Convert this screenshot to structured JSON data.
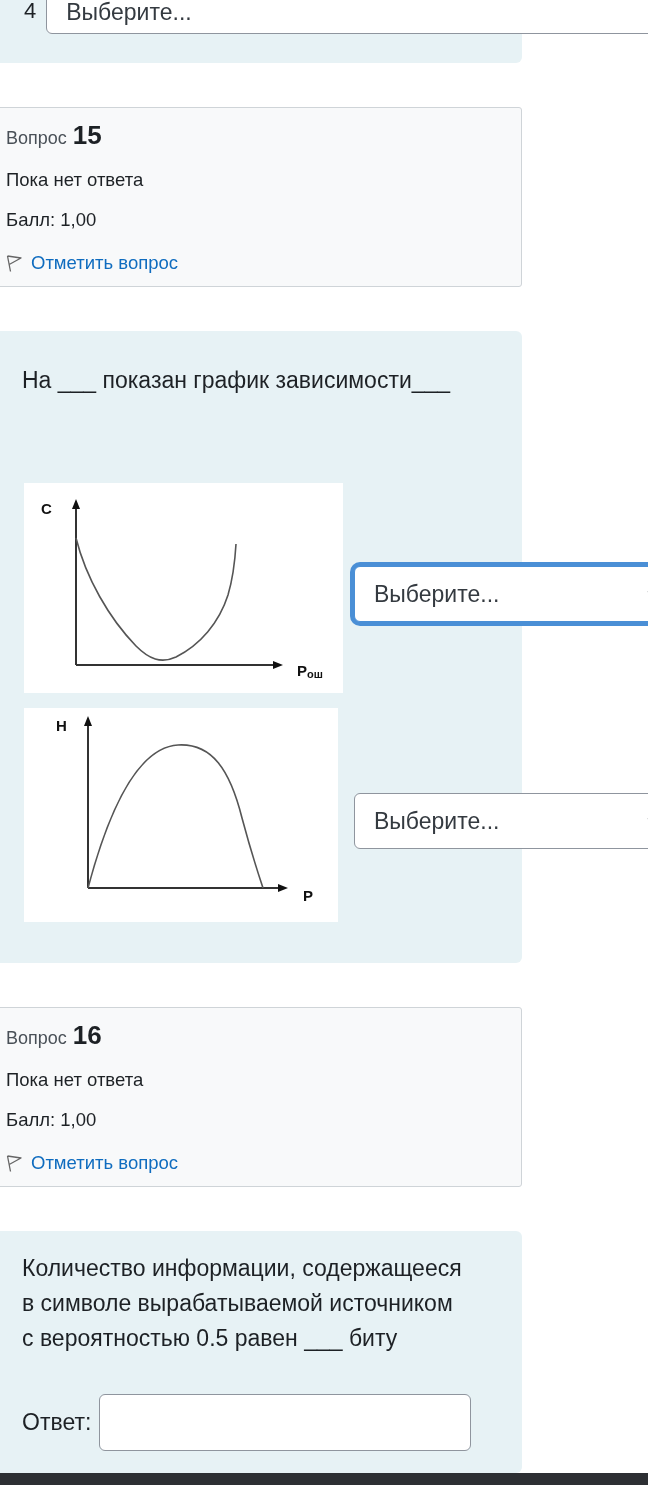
{
  "top_fragment": {
    "row_number": "4",
    "select": {
      "value": "Выберите...",
      "focused": false
    }
  },
  "questions": [
    {
      "info": {
        "label": "Вопрос",
        "number": "15",
        "status": "Пока нет ответа",
        "grade": "Балл: 1,00",
        "flag_link": "Отметить вопрос"
      },
      "kind": "match",
      "text": "На ___ показан график зависимости___",
      "items": [
        {
          "figure": {
            "kind": "u-curve",
            "y_label": "C",
            "x_label": "P$_{ош}$"
          },
          "select": {
            "value": "Выберите...",
            "focused": true
          }
        },
        {
          "figure": {
            "kind": "arch",
            "y_label": "H",
            "x_label": "P"
          },
          "select": {
            "value": "Выберите...",
            "focused": false
          }
        }
      ]
    },
    {
      "info": {
        "label": "Вопрос",
        "number": "16",
        "status": "Пока нет ответа",
        "grade": "Балл: 1,00",
        "flag_link": "Отметить вопрос"
      },
      "kind": "short-answer",
      "text": "Количество информации, содержащееся в символе вырабатываемой источником с вероятностью 0.5 равен ___ биту",
      "answer_label": "Ответ:"
    }
  ]
}
